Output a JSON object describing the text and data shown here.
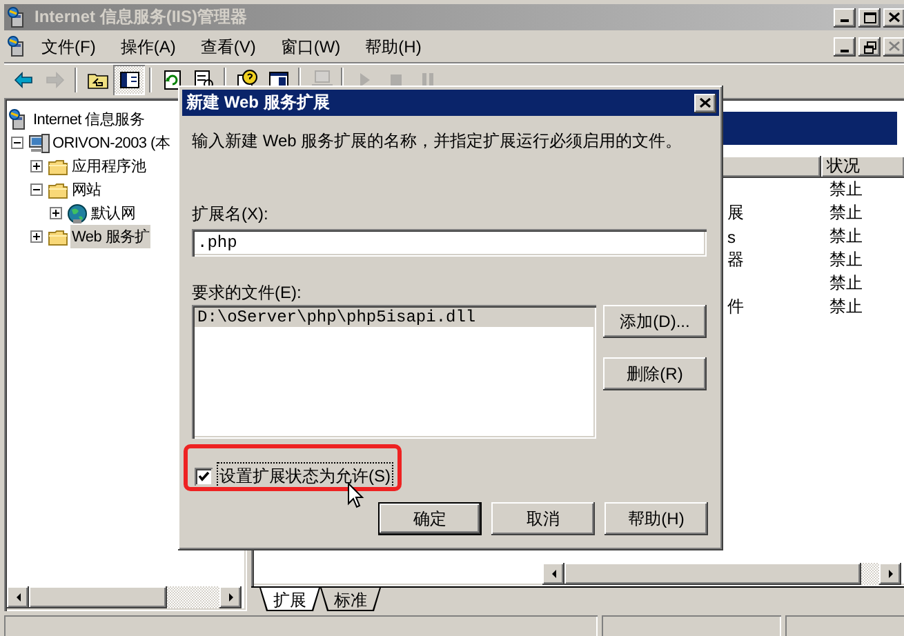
{
  "window": {
    "title": "Internet 信息服务(IIS)管理器"
  },
  "menu": [
    {
      "label": "文件(F)"
    },
    {
      "label": "操作(A)"
    },
    {
      "label": "查看(V)"
    },
    {
      "label": "窗口(W)"
    },
    {
      "label": "帮助(H)"
    }
  ],
  "toolbar": [
    {
      "kind": "back",
      "disabled": false,
      "on": false
    },
    {
      "kind": "forward",
      "disabled": true,
      "on": false
    },
    {
      "kind": "separator"
    },
    {
      "kind": "up",
      "disabled": false,
      "on": false
    },
    {
      "kind": "tree",
      "disabled": false,
      "on": true
    },
    {
      "kind": "separator"
    },
    {
      "kind": "refresh",
      "disabled": false,
      "on": false
    },
    {
      "kind": "export",
      "disabled": false,
      "on": false
    },
    {
      "kind": "separator"
    },
    {
      "kind": "help",
      "disabled": false,
      "on": false
    },
    {
      "kind": "properties",
      "disabled": false,
      "on": false
    },
    {
      "kind": "separator"
    },
    {
      "kind": "computer",
      "disabled": true,
      "on": false
    },
    {
      "kind": "separator"
    },
    {
      "kind": "play",
      "disabled": true,
      "on": false
    },
    {
      "kind": "stop",
      "disabled": true,
      "on": false
    },
    {
      "kind": "pause",
      "disabled": true,
      "on": false
    }
  ],
  "tree": [
    {
      "label": "Internet 信息服务",
      "kind": "root",
      "selected": false,
      "children": [
        {
          "label": "ORIVON-2003 (本",
          "kind": "server",
          "expanded": true,
          "selected": false,
          "children": [
            {
              "label": "应用程序池",
              "kind": "folder",
              "expanded": false,
              "selected": false
            },
            {
              "label": "网站",
              "kind": "folder",
              "expanded": true,
              "selected": false,
              "children": [
                {
                  "label": "默认网",
                  "kind": "site",
                  "expanded": false,
                  "selected": false
                }
              ]
            },
            {
              "label": "Web 服务扩",
              "kind": "folder",
              "expanded": false,
              "selected": true
            }
          ]
        }
      ]
    }
  ],
  "details": {
    "status_header": "状况",
    "rows": [
      {
        "status": "禁止"
      },
      {
        "name": "展",
        "status": "禁止"
      },
      {
        "name": "s",
        "status": "禁止"
      },
      {
        "name": "器",
        "status": "禁止"
      },
      {
        "status": "禁止"
      },
      {
        "name": "件",
        "status": "禁止"
      }
    ]
  },
  "view_tabs": [
    {
      "label": "扩展",
      "selected": true
    },
    {
      "label": "标准",
      "selected": false
    }
  ],
  "dialog": {
    "title": "新建 Web 服务扩展",
    "description": "输入新建 Web 服务扩展的名称，并指定扩展运行必须启用的文件。",
    "name_label": "扩展名(X):",
    "name_value": ".php",
    "files_label": "要求的文件(E):",
    "files": [
      {
        "path": "D:\\oServer\\php\\php5isapi.dll",
        "selected": true
      }
    ],
    "file_buttons": [
      "添加(D)...",
      "删除(R)"
    ],
    "allow": {
      "label": "设置扩展状态为允许(S)",
      "checked": true
    },
    "buttons": [
      "确定",
      "取消",
      "帮助(H)"
    ]
  }
}
